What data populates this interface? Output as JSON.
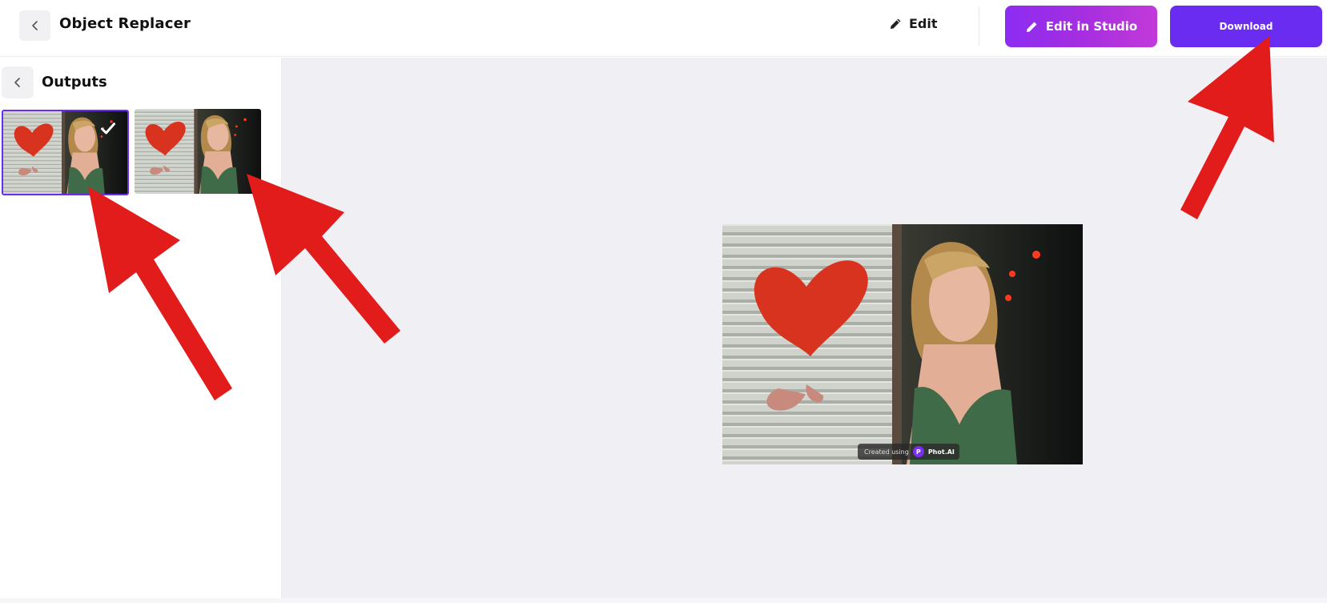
{
  "header": {
    "title": "Object Replacer",
    "edit_label": "Edit",
    "studio_label": "Edit in Studio",
    "download_label": "Download",
    "back_icon": "chevron-left-icon",
    "edit_icon": "pencil-icon"
  },
  "sidebar": {
    "title": "Outputs",
    "back_icon": "chevron-left-icon",
    "outputs": [
      {
        "selected": true,
        "check_icon": "check-icon"
      },
      {
        "selected": false
      }
    ]
  },
  "preview": {
    "watermark_text": "Created using",
    "watermark_logo": "P",
    "watermark_brand": "Phot.AI"
  },
  "colors": {
    "accent": "#6a2cf0",
    "studio_gradient_start": "#8c2cf2",
    "studio_gradient_end": "#c23ad9",
    "canvas_bg": "#efeff4",
    "annotation_arrow": "#e21b1b"
  }
}
